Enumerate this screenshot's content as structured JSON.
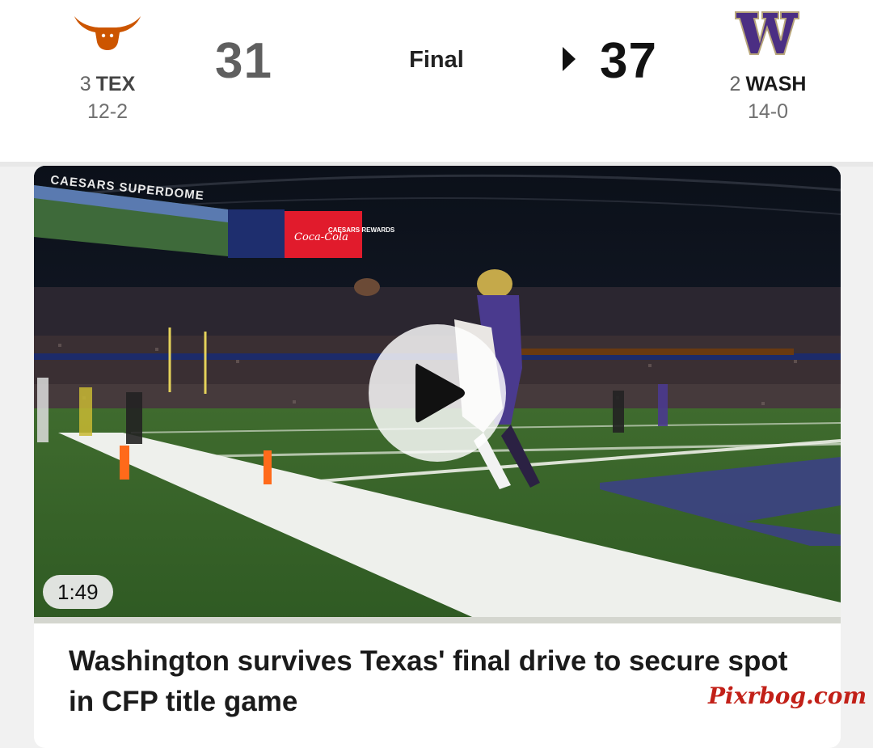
{
  "game": {
    "status": "Final",
    "away": {
      "rank": "3",
      "abbr": "TEX",
      "record": "12-2",
      "score": "31",
      "logo_icon": "longhorn-logo-icon",
      "color": "#cc5500"
    },
    "home": {
      "rank": "2",
      "abbr": "WASH",
      "record": "14-0",
      "score": "37",
      "logo_icon": "w-logo-icon",
      "color": "#4b2e83",
      "outline_color": "#b7a57a",
      "winner": true
    },
    "winner_indicator_icon": "triangle-right-icon"
  },
  "video": {
    "duration": "1:49",
    "play_icon": "play-icon",
    "stadium_sign": "CAESARS SUPERDOME",
    "board_ads": [
      "Coca-Cola",
      "CAESARS REWARDS"
    ],
    "field_color": "#3f6b2e",
    "end_zone_color": "#3c3f8a"
  },
  "article": {
    "headline": "Washington survives Texas' final drive to secure spot in CFP title game"
  },
  "watermark": "Pixrbog.com"
}
